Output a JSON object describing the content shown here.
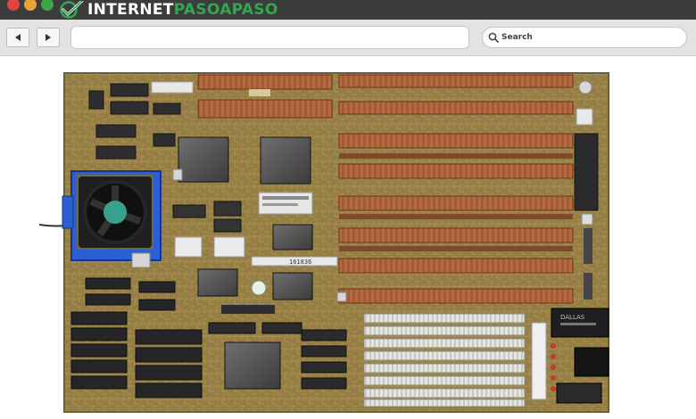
{
  "window": {
    "traffic_lights": [
      "#e0443e",
      "#e8a23a",
      "#3ea548"
    ]
  },
  "brand": {
    "name_part1": "INTERNET",
    "name_part2": "PASOAPASO",
    "part1_color": "#ffffff",
    "part2_color": "#2fa84f",
    "mark_color": "#2fa84f"
  },
  "toolbar": {
    "back_icon": "arrow-left-icon",
    "forward_icon": "arrow-right-icon",
    "url_value": "",
    "search_placeholder": "Search",
    "search_icon": "magnifier-icon"
  },
  "content": {
    "image_subject": "motherboard-photo",
    "board_labels": {
      "module_label": "DALLAS",
      "serial_label": "161836"
    }
  }
}
